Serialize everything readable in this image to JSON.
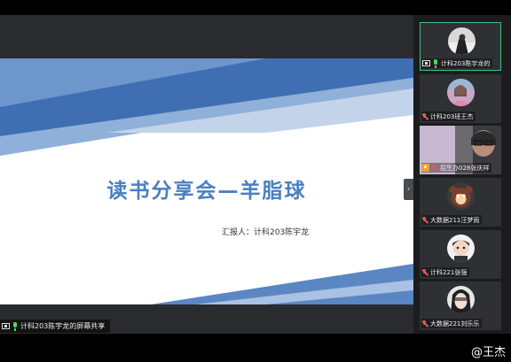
{
  "slide": {
    "title": "读书分享会—羊脂球",
    "presenter": "汇报人：计科203陈宇龙"
  },
  "share_label": "计科203陈宇龙的屏幕共享",
  "collapse_icon": "›",
  "participants": [
    {
      "name": "计科203陈宇龙的",
      "mic": "on",
      "icon": "screen-share-icon"
    },
    {
      "name": "计科203班王杰",
      "mic": "muted"
    },
    {
      "name": "招生办028张庆祥",
      "mic": "muted",
      "icon": "user-icon"
    },
    {
      "name": "大数据211汪梦雨",
      "mic": "muted"
    },
    {
      "name": "计科221张强",
      "mic": "muted"
    },
    {
      "name": "大数据221刘乐乐",
      "mic": "muted"
    }
  ],
  "watermark": "@王杰",
  "colors": {
    "accent": "#4a7fc0",
    "active_border": "#3fbf7f",
    "mic_on": "#4cd964",
    "mic_off": "#e05a5a"
  }
}
